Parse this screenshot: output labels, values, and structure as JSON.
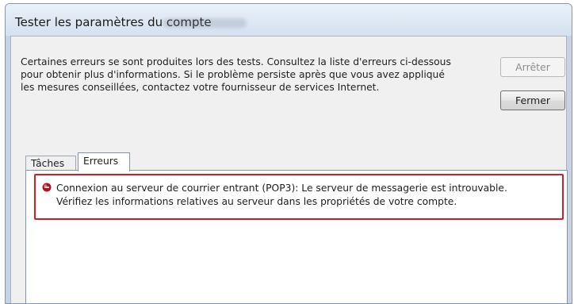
{
  "window": {
    "title": "Tester les paramètres du compte"
  },
  "message": {
    "lines": [
      "Certaines erreurs se sont produites lors des tests. Consultez la liste d'erreurs ci-dessous",
      "pour obtenir plus d'informations. Si le problème persiste après que vous avez appliqué",
      "les mesures conseillées, contactez votre fournisseur de services Internet."
    ]
  },
  "buttons": {
    "stop_label": "Arrêter",
    "close_label": "Fermer"
  },
  "tabs": [
    {
      "label": "Tâches",
      "selected": false
    },
    {
      "label": "Erreurs",
      "selected": true
    }
  ],
  "errors": [
    {
      "icon": "error-icon",
      "lines": [
        "Connexion au serveur de courrier entrant (POP3): Le serveur de messagerie est introuvable.",
        "Vérifiez les informations relatives au serveur dans les propriétés de votre compte."
      ]
    }
  ],
  "colors": {
    "error_highlight": "#cc1f2b",
    "error_icon": "#b3121d"
  }
}
